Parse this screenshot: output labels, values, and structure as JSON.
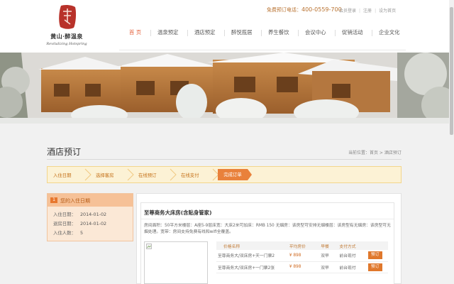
{
  "header": {
    "logo_brand": "黄山·醉温泉",
    "logo_sub": "Revitalizing Hotspring",
    "hotline_label": "免费预订电话：",
    "hotline_number": "400-0559-700",
    "top_links": [
      "会员登录",
      "注册",
      "设为首页"
    ]
  },
  "nav": {
    "items": [
      "首 页",
      "温泉预定",
      "酒店预定",
      "醉悦揽居",
      "养生餐饮",
      "会议中心",
      "促销活动",
      "企业文化"
    ],
    "active_index": 0
  },
  "page": {
    "title": "酒店预订",
    "breadcrumb": "当前位置：首页 > 酒店预订"
  },
  "steps": {
    "items": [
      "入住日期",
      "选择客房",
      "在线预订",
      "在线支付"
    ],
    "active": "完成订单"
  },
  "checkin_panel": {
    "number": "1",
    "title": "您的入住日期",
    "rows": [
      {
        "label": "入住日期：",
        "value": "2014-01-02"
      },
      {
        "label": "退房日期：",
        "value": "2014-01-02"
      },
      {
        "label": "入住人数：",
        "value": "5"
      }
    ]
  },
  "room": {
    "name": "至尊商务大床房(含贴身管家)",
    "description": "房间面积：50平方米楼层：A座5-9层床宽：大床2米可加床：RMB 150 无烟房：该房型可安排无烟楼层：该房型有无烟房：该房型可无烟处理。宽带：房间支持免费有线和wifi全覆盖。",
    "table_headers": [
      "价格名称",
      "平均房价",
      "早餐",
      "支付方式"
    ],
    "rates": [
      {
        "name": "至尊商务大/双床房+天一门票2",
        "price": "¥ 898",
        "breakfast": "双早",
        "payment": "前台现付",
        "button": "预订"
      },
      {
        "name": "至尊商务大/双床房+一门票2张",
        "price": "¥ 898",
        "breakfast": "双早",
        "payment": "前台现付",
        "button": "预订"
      }
    ]
  },
  "colors": {
    "accent": "#e9813b",
    "nav_active": "#e4633e",
    "hotline": "#b8712f"
  }
}
